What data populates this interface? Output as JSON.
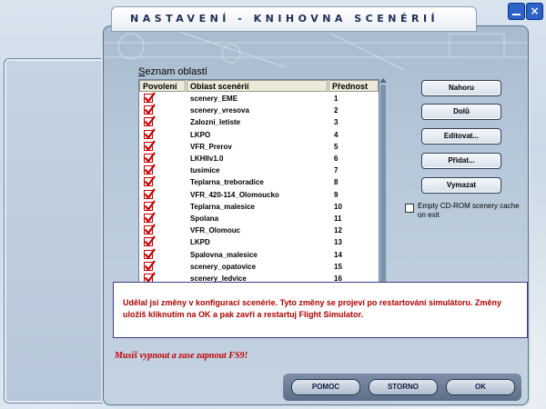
{
  "dialog": {
    "title": "NASTAVENÍ - KNIHOVNA SCENÉRIÍ"
  },
  "list": {
    "label_ul": "S",
    "label_rest": "eznam oblastí",
    "columns": [
      "Povolení",
      "Oblast scenérií",
      "Přednost"
    ],
    "rows": [
      {
        "name": "scenery_EME",
        "priority": "1",
        "enabled": true
      },
      {
        "name": "scenery_vresova",
        "priority": "2",
        "enabled": true
      },
      {
        "name": "Zalozni_letiste",
        "priority": "3",
        "enabled": true
      },
      {
        "name": "LKPO",
        "priority": "4",
        "enabled": true
      },
      {
        "name": "VFR_Prerov",
        "priority": "5",
        "enabled": true
      },
      {
        "name": "LKHIlv1.0",
        "priority": "6",
        "enabled": true
      },
      {
        "name": "tusimice",
        "priority": "7",
        "enabled": true
      },
      {
        "name": "Teplarna_treboradice",
        "priority": "8",
        "enabled": true
      },
      {
        "name": "VFR_420-114_Olomoucko",
        "priority": "9",
        "enabled": true
      },
      {
        "name": "Teplarna_malesice",
        "priority": "10",
        "enabled": true
      },
      {
        "name": "Spolana",
        "priority": "11",
        "enabled": true
      },
      {
        "name": "VFR_Olomouc",
        "priority": "12",
        "enabled": true
      },
      {
        "name": "LKPD",
        "priority": "13",
        "enabled": true
      },
      {
        "name": "Spalovna_malesice",
        "priority": "14",
        "enabled": true
      },
      {
        "name": "scenery_opatovice",
        "priority": "15",
        "enabled": true
      },
      {
        "name": "scenery_ledvice",
        "priority": "16",
        "enabled": true
      }
    ]
  },
  "buttons": {
    "up": "Nahoru",
    "down": "Dolů",
    "edit": "Editovat...",
    "add": "Přidat...",
    "delete": "Vymazat"
  },
  "cache_option": {
    "label": "Empty CD-ROM scenery cache on exit",
    "checked": false
  },
  "info": {
    "message": "Udělal jsi změny v konfiguraci scenérie. Tyto změny se projeví po restartování simulátoru. Změny uložíš kliknutím na OK a pak zavři a restartuj Flight Simulator."
  },
  "note": "Musíš vypnout a zase zapnout FS9!",
  "footer": {
    "help": "POMOC",
    "cancel": "STORNO",
    "ok": "OK"
  },
  "colors": {
    "checkbox_red": "#cc0000",
    "info_text": "#b00000",
    "note_text": "#c00000",
    "title_text": "#1e2d55"
  }
}
